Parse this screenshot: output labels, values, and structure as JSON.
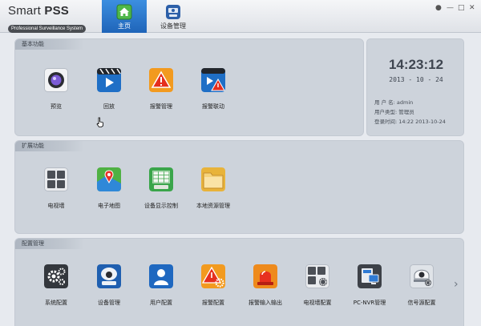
{
  "app": {
    "name_regular": "Smart ",
    "name_bold": "PSS",
    "tagline": "Professional Surveillance System"
  },
  "tabs": [
    {
      "label": "主页",
      "icon": "home-icon",
      "active": true
    },
    {
      "label": "设备管理",
      "icon": "device-manager-icon",
      "active": false
    }
  ],
  "window_controls": [
    "lock-icon",
    "minimize-icon",
    "restore-icon",
    "close-icon"
  ],
  "sections": {
    "basic": {
      "title": "基本功能",
      "items": [
        {
          "label": "预览",
          "icon": "preview-camera-icon"
        },
        {
          "label": "回放",
          "icon": "playback-icon"
        },
        {
          "label": "报警管理",
          "icon": "alarm-manage-icon"
        },
        {
          "label": "报警联动",
          "icon": "alarm-link-icon"
        }
      ]
    },
    "extended": {
      "title": "扩展功能",
      "items": [
        {
          "label": "电视墙",
          "icon": "tv-wall-icon"
        },
        {
          "label": "电子地图",
          "icon": "emap-icon"
        },
        {
          "label": "设备显示控制",
          "icon": "display-control-icon"
        },
        {
          "label": "本地资源管理",
          "icon": "local-resource-icon"
        }
      ]
    },
    "config": {
      "title": "配置管理",
      "items": [
        {
          "label": "系统配置",
          "icon": "system-config-icon"
        },
        {
          "label": "设备管理",
          "icon": "device-manage-icon"
        },
        {
          "label": "用户配置",
          "icon": "user-config-icon"
        },
        {
          "label": "报警配置",
          "icon": "alarm-config-icon"
        },
        {
          "label": "报警输入输出",
          "icon": "alarm-io-icon"
        },
        {
          "label": "电视墙配置",
          "icon": "tv-wall-config-icon"
        },
        {
          "label": "PC-NVR管理",
          "icon": "pc-nvr-icon"
        },
        {
          "label": "信号源配置",
          "icon": "signal-source-icon"
        }
      ]
    }
  },
  "clock": {
    "time": "14:23:12",
    "date": "2013 - 10 - 24",
    "user_label": "用 户 名:",
    "user_value": "admin",
    "type_label": "用户类型:",
    "type_value": "管理员",
    "login_label": "登录时间:",
    "login_value": "14:22  2013-10-24"
  },
  "nav": {
    "next_arrow": "›"
  },
  "colors": {
    "tab_active": "#2f7ad4",
    "panel": "#cdd3db",
    "header": "#e8ebef"
  }
}
